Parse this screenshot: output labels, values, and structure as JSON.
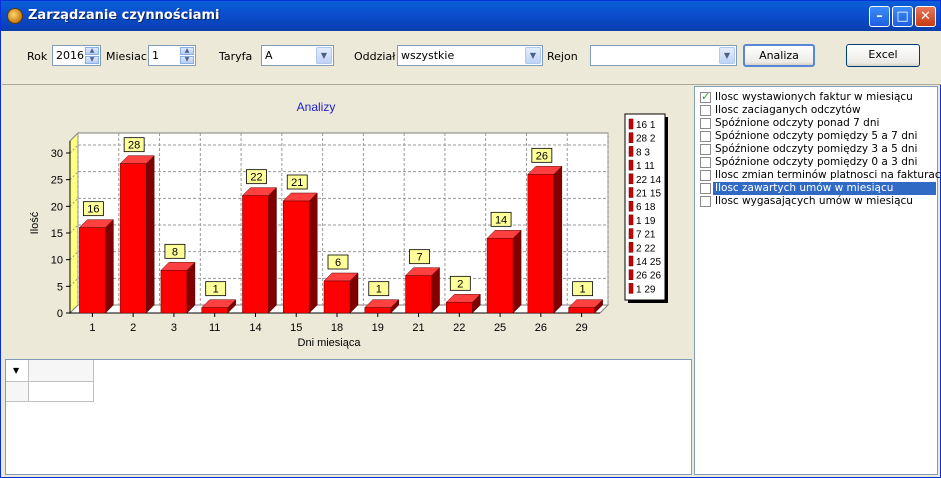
{
  "window": {
    "title": "Zarządzanie czynnościami"
  },
  "toolbar": {
    "rok_label": "Rok",
    "rok_value": "2016",
    "miesiac_label": "Miesiac",
    "miesiac_value": "1",
    "taryfa_label": "Taryfa",
    "taryfa_value": "A",
    "oddzial_label": "Oddział",
    "oddzial_value": "wszystkie",
    "rejon_label": "Rejon",
    "rejon_value": "",
    "analiza_label": "Analiza",
    "excel_label": "Excel"
  },
  "chart_data": {
    "type": "bar",
    "title": "Analizy",
    "xlabel": "Dni miesiąca",
    "ylabel": "Ilość",
    "categories": [
      "1",
      "2",
      "3",
      "11",
      "14",
      "15",
      "18",
      "19",
      "21",
      "22",
      "25",
      "26",
      "29"
    ],
    "values": [
      16,
      28,
      8,
      1,
      22,
      21,
      6,
      1,
      7,
      2,
      14,
      26,
      1
    ],
    "ylim": [
      0,
      30
    ],
    "yticks": [
      0,
      5,
      10,
      15,
      20,
      25,
      30
    ],
    "grid": true,
    "legend": "right",
    "legend_entries": [
      "16 1",
      "28 2",
      "8 3",
      "1 11",
      "22 14",
      "21 15",
      "6 18",
      "1 19",
      "7 21",
      "2 22",
      "14 25",
      "26 26",
      "1 29"
    ],
    "color": "#ff0000"
  },
  "options": [
    {
      "label": "Ilosc wystawionych faktur w miesiącu",
      "checked": true,
      "selected": false
    },
    {
      "label": "Ilosc zaciaganych odczytów",
      "checked": false,
      "selected": false
    },
    {
      "label": "Spóźnione odczyty ponad 7 dni",
      "checked": false,
      "selected": false
    },
    {
      "label": "Spóźnione odczyty pomiędzy 5 a 7 dni",
      "checked": false,
      "selected": false
    },
    {
      "label": "Spóźnione odczyty pomiędzy 3 a 5 dni",
      "checked": false,
      "selected": false
    },
    {
      "label": "Spóźnione odczyty pomiędzy 0 a 3 dni",
      "checked": false,
      "selected": false
    },
    {
      "label": "Ilosc zmian terminów platnosci na fakturach",
      "checked": false,
      "selected": false
    },
    {
      "label": "Ilosc zawartych umów w miesiącu",
      "checked": false,
      "selected": true
    },
    {
      "label": "Ilosc wygasających umów w miesiącu",
      "checked": false,
      "selected": false
    }
  ]
}
